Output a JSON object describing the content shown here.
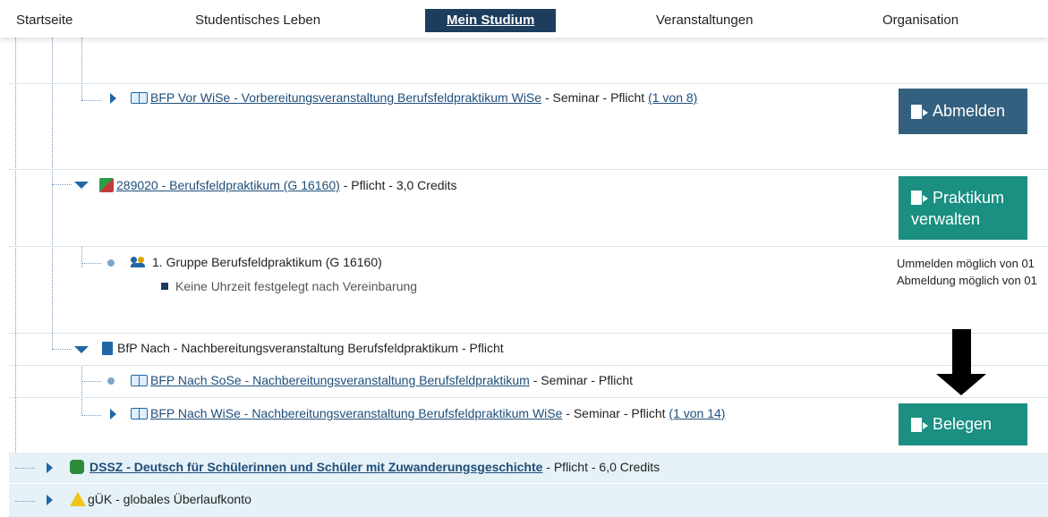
{
  "nav": {
    "items": [
      "Startseite",
      "Studentisches Leben",
      "Mein Studium",
      "Veranstaltungen",
      "Organisation"
    ]
  },
  "rows": {
    "bfp_vor": {
      "title": "BFP Vor WiSe - Vorbereitungsveranstaltung Berufsfeldpraktikum WiSe",
      "meta": " - Seminar - Pflicht ",
      "count": "(1 von 8)"
    },
    "modul": {
      "title": "289020 - Berufsfeldpraktikum (G 16160)",
      "meta": " - Pflicht - 3,0 Credits"
    },
    "gruppe": {
      "title": "1. Gruppe Berufsfeldpraktikum (G 16160)",
      "time": "Keine Uhrzeit festgelegt nach Vereinbarung",
      "note1": "Ummelden möglich von 01",
      "note2": "Abmeldung möglich von 01"
    },
    "bfp_nach": {
      "title": "BfP Nach - Nachbereitungsveranstaltung Berufsfeldpraktikum - Pflicht"
    },
    "bfp_nach_sose": {
      "title": "BFP Nach SoSe - Nachbereitungsveranstaltung Berufsfeldpraktikum",
      "meta": " - Seminar - Pflicht"
    },
    "bfp_nach_wise": {
      "title": "BFP Nach WiSe - Nachbereitungsveranstaltung Berufsfeldpraktikum WiSe",
      "meta": " - Seminar - Pflicht ",
      "count": "(1 von 14)"
    },
    "dssz": {
      "title": "DSSZ - Deutsch für Schülerinnen und Schüler mit Zuwanderungsgeschichte",
      "meta": " - Pflicht - 6,0 Credits"
    },
    "guek": {
      "title": "gÜK - globales Überlaufkonto"
    }
  },
  "buttons": {
    "abmelden": "Abmelden",
    "praktikum_1": "Praktikum",
    "praktikum_2": "verwalten",
    "belegen": "Belegen"
  },
  "colors": {
    "nav_active": "#1d3d5e",
    "button_dark": "#33607f",
    "button_teal": "#1a8f82",
    "link": "#1f4e79"
  }
}
